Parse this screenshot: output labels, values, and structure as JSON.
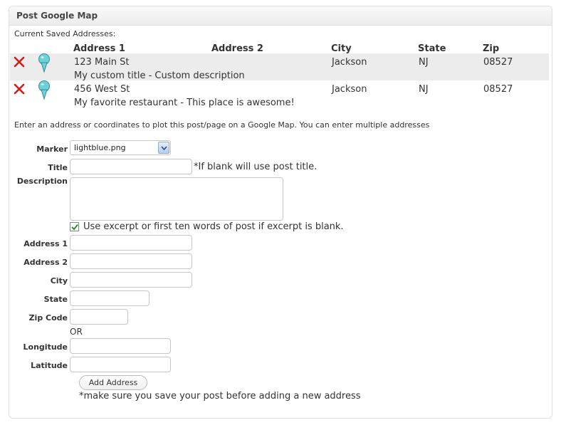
{
  "panel": {
    "title": "Post Google Map"
  },
  "saved": {
    "caption": "Current Saved Addresses:",
    "columns": [
      "Address 1",
      "Address 2",
      "City",
      "State",
      "Zip"
    ],
    "rows": [
      {
        "address1": "123 Main St",
        "address2": "",
        "city": "Jackson",
        "state": "NJ",
        "zip": "08527",
        "note": "My custom title - Custom description",
        "marker_icon": "lightblue-pin-icon"
      },
      {
        "address1": "456 West St",
        "address2": "",
        "city": "Jackson",
        "state": "NJ",
        "zip": "08527",
        "note": "My favorite restaurant - This place is awesome!",
        "marker_icon": "lightblue-pin-icon"
      }
    ]
  },
  "form": {
    "intro": "Enter an address or coordinates to plot this post/page on a Google Map. You can enter multiple addresses",
    "marker_label": "Marker",
    "marker_value": "lightblue.png",
    "title_label": "Title",
    "title_hint": "*If blank will use post title.",
    "description_label": "Description",
    "excerpt_checkbox_label": "Use excerpt or first ten words of post if excerpt is blank.",
    "excerpt_checked": true,
    "address1_label": "Address 1",
    "address2_label": "Address 2",
    "city_label": "City",
    "state_label": "State",
    "zip_label": "Zip Code",
    "or_text": "OR",
    "longitude_label": "Longitude",
    "latitude_label": "Latitude",
    "add_button": "Add Address",
    "save_note": "*make sure you save your post before adding a new address"
  },
  "colors": {
    "delete": "#d21c1c",
    "pin": "#6fd0d8",
    "row_alt": "#ececec"
  }
}
